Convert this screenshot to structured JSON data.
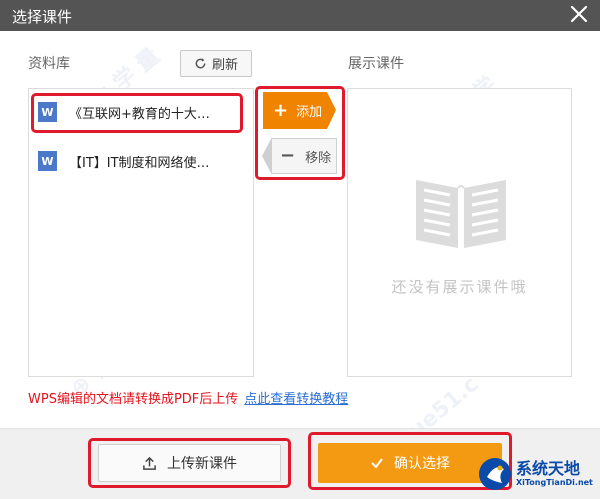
{
  "window": {
    "title": "选择课件"
  },
  "library": {
    "label": "资料库",
    "refresh_label": "刷新",
    "items": [
      {
        "icon": "W",
        "name": "《互联网+教育的十大…"
      },
      {
        "icon": "W",
        "name": "【IT】IT制度和网络使…"
      }
    ]
  },
  "actions": {
    "add_label": "添加",
    "remove_label": "移除"
  },
  "showcase": {
    "label": "展示课件",
    "empty_text": "还没有展示课件哦"
  },
  "notice": {
    "text": "WPS编辑的文档请转换成PDF后上传",
    "link": "点此查看转换教程"
  },
  "footer": {
    "upload_label": "上传新课件",
    "confirm_label": "确认选择"
  },
  "logo": {
    "cn": "系统天地",
    "en": "XiTongTianDi.net"
  },
  "colors": {
    "accent": "#f08300",
    "highlight": "#e0192c",
    "link": "#2b6fd1",
    "titlebar": "#545454"
  }
}
